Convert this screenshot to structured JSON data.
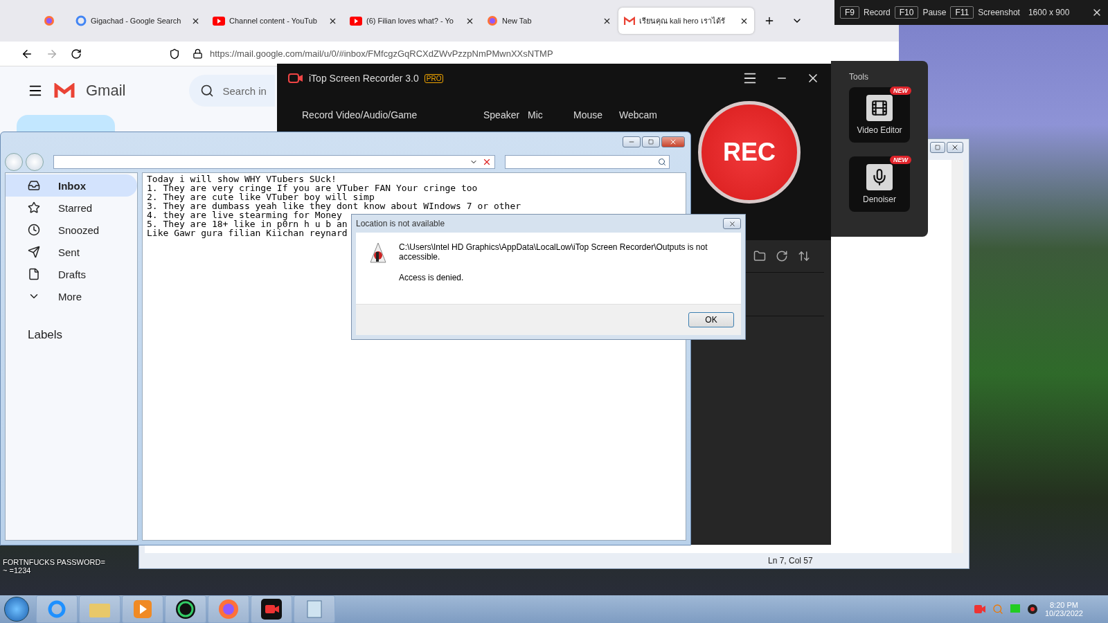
{
  "hotkey_bar": {
    "items": [
      {
        "key": "F9",
        "label": "Record"
      },
      {
        "key": "F10",
        "label": "Pause"
      },
      {
        "key": "F11",
        "label": "Screenshot"
      }
    ],
    "resolution": "1600 x 900"
  },
  "browser": {
    "tabs": [
      {
        "kind": "firefox",
        "selected": false
      },
      {
        "kind": "google",
        "title": "Gigachad - Google Search",
        "selected": false
      },
      {
        "kind": "youtube",
        "title": "Channel content - YouTub",
        "selected": false
      },
      {
        "kind": "youtube",
        "title": "(6) Filian loves what? - Yo",
        "selected": false
      },
      {
        "kind": "firefox",
        "title": "New Tab",
        "selected": false
      },
      {
        "kind": "gmail",
        "title": "เรียนคุณ kali hero เราได้รั",
        "selected": true
      }
    ],
    "url": "https://mail.google.com/mail/u/0/#inbox/FMfcgzGqRCXdZWvPzzpNmPMwnXXsNTMP"
  },
  "gmail": {
    "logo_text": "Gmail",
    "search_placeholder": "Search in",
    "nav": [
      {
        "kind": "inbox",
        "label": "Inbox",
        "selected": true
      },
      {
        "kind": "star",
        "label": "Starred",
        "selected": false
      },
      {
        "kind": "clock",
        "label": "Snoozed",
        "selected": false
      },
      {
        "kind": "send",
        "label": "Sent",
        "selected": false
      },
      {
        "kind": "file",
        "label": "Drafts",
        "selected": false
      },
      {
        "kind": "more",
        "label": "More",
        "selected": false
      }
    ],
    "labels_heading": "Labels"
  },
  "text_window": {
    "lines": [
      "Today i will show WHY VTubers SUck!",
      "1. They are very cringe If you are VTuber FAN Your cringe too",
      "2. They are cute like VTuber boy will simp",
      "3. They are dumbass yeah like they dont know about WIndows 7 or other",
      "4. they are live stearming for Money",
      "5. They are 18+ like in p0rn h u b an",
      "Like Gawr gura filian Kiichan reynard"
    ]
  },
  "editor": {
    "status": "Ln 7, Col 57"
  },
  "recorder": {
    "title": "iTop Screen Recorder 3.0",
    "badge": "PRO",
    "source_label": "Record Video/Audio/Game",
    "options": [
      "Speaker",
      "Mic",
      "Mouse",
      "Webcam"
    ],
    "rec_label": "REC",
    "tools_heading": "Tools",
    "tools": [
      {
        "kind": "video",
        "label": "Video Editor",
        "badge": "NEW"
      },
      {
        "kind": "denoise",
        "label": "Denoiser",
        "badge": "NEW"
      }
    ]
  },
  "dialog": {
    "title": "Location is not available",
    "message": "C:\\Users\\Intel HD Graphics\\AppData\\LocalLow\\iTop Screen Recorder\\Outputs is not accessible.",
    "detail": "Access is denied.",
    "button": "OK"
  },
  "desktop_note": [
    "FORTNFUCKS PASSWORD=",
    "~ =1234"
  ],
  "taskbar": {
    "apps": [
      {
        "kind": "ie"
      },
      {
        "kind": "explorer"
      },
      {
        "kind": "media"
      },
      {
        "kind": "u"
      },
      {
        "kind": "firefox"
      },
      {
        "kind": "recorder"
      },
      {
        "kind": "notepad"
      }
    ],
    "time": "8:20 PM",
    "date": "10/23/2022"
  }
}
